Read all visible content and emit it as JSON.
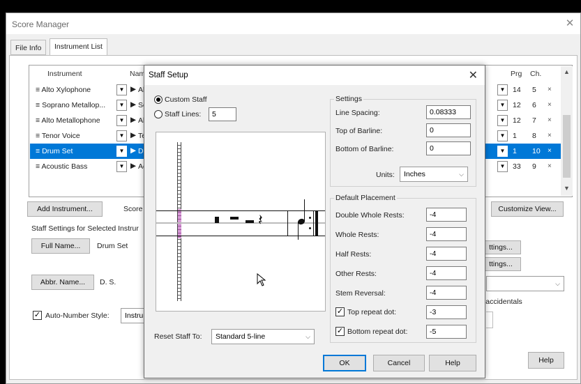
{
  "score_manager": {
    "title": "Score Manager",
    "close": "✕",
    "tabs": [
      "File Info",
      "Instrument List"
    ],
    "columns": {
      "instrument": "Instrument",
      "name": "Nam",
      "prg": "Prg",
      "ch": "Ch."
    },
    "rows": [
      {
        "instrument": "Alto Xylophone",
        "name": "Al",
        "prg": "14",
        "ch": "5",
        "selected": false
      },
      {
        "instrument": "Soprano Metallop...",
        "name": "Sc",
        "prg": "12",
        "ch": "6",
        "selected": false
      },
      {
        "instrument": "Alto Metallophone",
        "name": "Al",
        "prg": "12",
        "ch": "7",
        "selected": false
      },
      {
        "instrument": "Tenor Voice",
        "name": "Te",
        "prg": "1",
        "ch": "8",
        "selected": false
      },
      {
        "instrument": "Drum Set",
        "name": "Dr",
        "prg": "1",
        "ch": "10",
        "selected": true
      },
      {
        "instrument": "Acoustic Bass",
        "name": "Ac",
        "prg": "33",
        "ch": "9",
        "selected": false
      }
    ],
    "row_marker": "≡",
    "play_glyph": "▶",
    "x_glyph": "×",
    "add_instrument": "Add Instrument...",
    "score_label": "Score",
    "customize_view": "Customize View...",
    "staff_settings_label": "Staff Settings for Selected Instrur",
    "full_name_button": "Full Name...",
    "full_name_value": "Drum Set",
    "abbr_name_button": "Abbr. Name...",
    "abbr_name_value": "D. S.",
    "auto_number_label": "Auto-Number Style:",
    "auto_number_checked": true,
    "auto_number_value": "Instrum",
    "settings_btn_1": "ttings...",
    "settings_btn_2": "ttings...",
    "accidentals_label": "l accidentals",
    "help": "Help"
  },
  "staff_setup": {
    "title": "Staff Setup",
    "close": "✕",
    "custom_staff": "Custom Staff",
    "staff_lines_label": "Staff Lines:",
    "staff_lines_value": "5",
    "settings_group": "Settings",
    "line_spacing_label": "Line Spacing:",
    "line_spacing_value": "0.08333",
    "top_barline_label": "Top of Barline:",
    "top_barline_value": "0",
    "bottom_barline_label": "Bottom of Barline:",
    "bottom_barline_value": "0",
    "units_label": "Units:",
    "units_value": "Inches",
    "default_placement_group": "Default Placement",
    "double_whole_rests_label": "Double Whole Rests:",
    "double_whole_rests_value": "-4",
    "whole_rests_label": "Whole Rests:",
    "whole_rests_value": "-4",
    "half_rests_label": "Half Rests:",
    "half_rests_value": "-4",
    "other_rests_label": "Other Rests:",
    "other_rests_value": "-4",
    "stem_reversal_label": "Stem Reversal:",
    "stem_reversal_value": "-4",
    "top_repeat_dot_label": "Top repeat dot:",
    "top_repeat_dot_value": "-3",
    "top_repeat_dot_checked": true,
    "bottom_repeat_dot_label": "Bottom repeat dot:",
    "bottom_repeat_dot_value": "-5",
    "bottom_repeat_dot_checked": true,
    "reset_staff_label": "Reset Staff To:",
    "reset_staff_value": "Standard 5-line",
    "ok": "OK",
    "cancel": "Cancel",
    "help": "Help"
  }
}
